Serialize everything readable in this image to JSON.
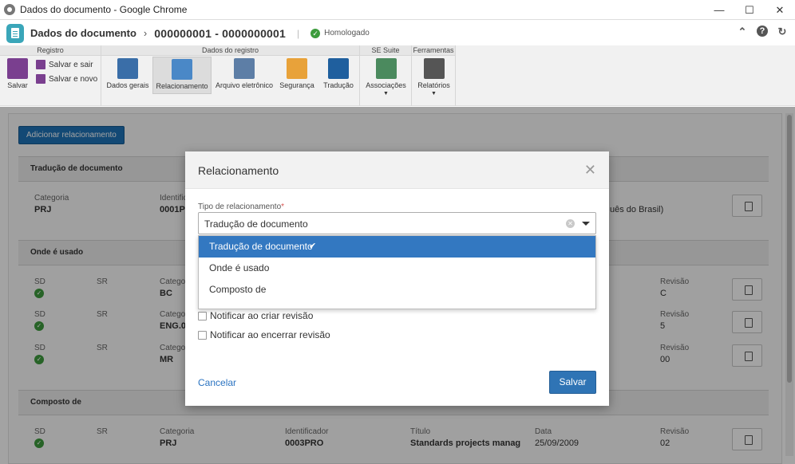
{
  "window": {
    "title": "Dados do documento - Google Chrome"
  },
  "header": {
    "title": "Dados do documento",
    "record_id": "000000001 - 0000000001",
    "status": "Homologado"
  },
  "ribbon": {
    "groups": [
      "Registro",
      "Dados do registro",
      "SE Suite",
      "Ferramentas"
    ],
    "save_label": "Salvar",
    "save_exit_label": "Salvar e sair",
    "save_new_label": "Salvar e novo",
    "items": {
      "dados_gerais": "Dados gerais",
      "relacionamento": "Relacionamento",
      "arquivo_eletronico": "Arquivo eletrônico",
      "seguranca": "Segurança",
      "traducao": "Tradução",
      "associacoes": "Associações",
      "relatorios": "Relatórios"
    }
  },
  "content": {
    "add_button": "Adicionar relacionamento",
    "sections": {
      "traducao": {
        "title": "Tradução de documento",
        "categoria_label": "Categoria",
        "categoria": "PRJ",
        "ident_label": "Identific",
        "ident": "0001P",
        "title_fragment": "uês do Brasil)"
      },
      "onde": {
        "title": "Onde é usado",
        "rows": [
          {
            "sd": "SD",
            "sr": "SR",
            "cat_label": "Categoria",
            "cat": "BC",
            "rev_label": "Revisão",
            "rev": "C"
          },
          {
            "sd": "SD",
            "sr": "SR",
            "cat_label": "Categor",
            "cat": "ENG.0",
            "rev_label": "Revisão",
            "rev": "5"
          },
          {
            "sd": "SD",
            "sr": "SR",
            "cat_label": "Categor",
            "cat": "MR",
            "rev_label": "Revisão",
            "rev": "00"
          }
        ]
      },
      "composto": {
        "title": "Composto de",
        "row": {
          "sd": "SD",
          "sr": "SR",
          "cat_label": "Categoria",
          "cat": "PRJ",
          "ident_label": "Identificador",
          "ident": "0003PRO",
          "title_label": "Título",
          "title": "Standards projects manag",
          "date_label": "Data",
          "date": "25/09/2009",
          "rev_label": "Revisão",
          "rev": "02"
        }
      }
    }
  },
  "modal": {
    "title": "Relacionamento",
    "field_label": "Tipo de relacionamento",
    "required_mark": "*",
    "selected_value": "Tradução de documento",
    "options": [
      "Tradução de documento",
      "Onde é usado",
      "Composto de"
    ],
    "checkbox_create": "Notificar ao criar revisão",
    "checkbox_close": "Notificar ao encerrar revisão",
    "cancel_label": "Cancelar",
    "save_label": "Salvar"
  },
  "colors": {
    "primary": "#1f73b7",
    "selected_option": "#3378c1",
    "status_green": "#3d9c3d"
  }
}
